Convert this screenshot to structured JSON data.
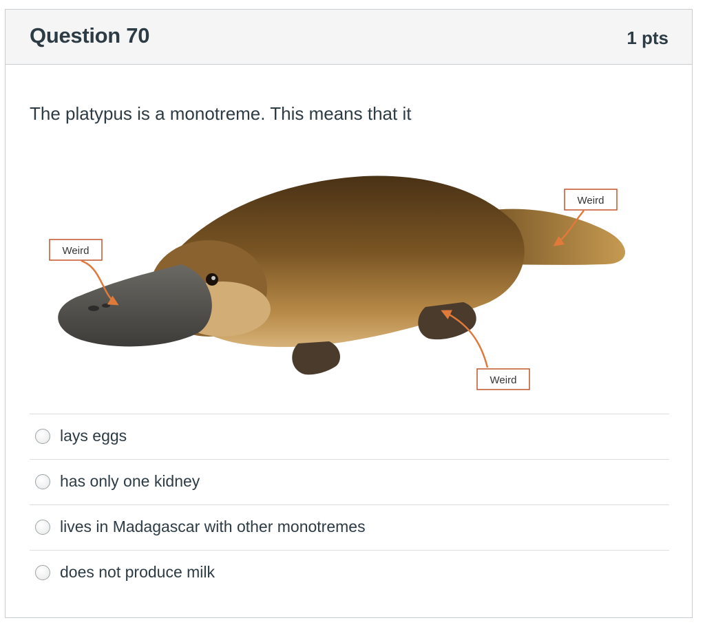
{
  "question": {
    "title": "Question 70",
    "points": "1 pts",
    "prompt": "The platypus is a monotreme. This means that it"
  },
  "figure": {
    "annotations": [
      {
        "label": "Weird"
      },
      {
        "label": "Weird"
      },
      {
        "label": "Weird"
      }
    ],
    "colors": {
      "annotation_border": "#c0542a",
      "arrow": "#e07a3a",
      "fur_dark": "#5a3a1a",
      "fur_light": "#a8742e",
      "bill": "#5b5a55"
    }
  },
  "answers": [
    {
      "label": "lays eggs"
    },
    {
      "label": "has only one kidney"
    },
    {
      "label": "lives in Madagascar with other monotremes"
    },
    {
      "label": "does not produce milk"
    }
  ]
}
